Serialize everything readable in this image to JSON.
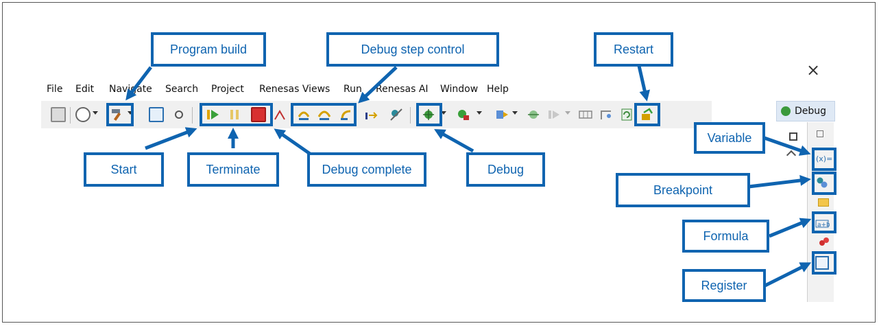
{
  "menu": {
    "file": "File",
    "edit": "Edit",
    "navigate": "Navigate",
    "search": "Search",
    "project": "Project",
    "renesas_views": "Renesas Views",
    "run": "Run",
    "renesas_ai": "Renesas AI",
    "window": "Window",
    "help": "Help"
  },
  "window": {
    "close_glyph": "×",
    "perspective_tab": "Debug"
  },
  "callouts": {
    "program_build": "Program build",
    "debug_step_control": "Debug step control",
    "restart": "Restart",
    "start": "Start",
    "terminate": "Terminate",
    "debug_complete": "Debug complete",
    "debug": "Debug",
    "variable": "Variable",
    "breakpoint": "Breakpoint",
    "formula": "Formula",
    "register": "Register"
  },
  "right_panel": {
    "variables_icon_text": "(x)="
  },
  "colors": {
    "callout_blue": "#0f64b0",
    "toolbar_bg": "#f0f0f0"
  },
  "icons": [
    "save-icon",
    "target-icon",
    "hammer-icon",
    "console-icon",
    "filter-icon",
    "resume-icon",
    "suspend-icon",
    "terminate-icon",
    "disconnect-icon",
    "step-into-icon",
    "step-over-icon",
    "step-return-icon",
    "instruction-step-icon",
    "skip-breakpoints-icon",
    "debug-bug-icon",
    "run-icon",
    "external-tools-icon",
    "coverage-icon",
    "restart-icon"
  ]
}
